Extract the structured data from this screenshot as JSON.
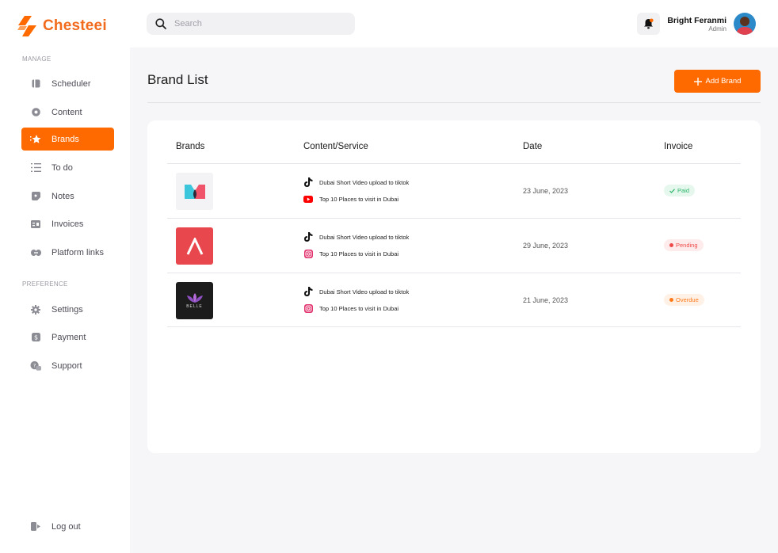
{
  "brand": {
    "name": "Chesteei",
    "accent": "#ff6a00"
  },
  "sidebar": {
    "manage_label": "MANAGE",
    "preference_label": "PREFERENCE",
    "manage_items": [
      {
        "label": "Scheduler",
        "icon": "calendar-icon"
      },
      {
        "label": "Content",
        "icon": "play-icon"
      },
      {
        "label": "Brands",
        "icon": "star-icon",
        "active": true
      },
      {
        "label": "To do",
        "icon": "list-icon"
      },
      {
        "label": "Notes",
        "icon": "note-icon"
      },
      {
        "label": "Invoices",
        "icon": "invoice-icon"
      },
      {
        "label": "Platform links",
        "icon": "link-icon"
      }
    ],
    "preference_items": [
      {
        "label": "Settings",
        "icon": "gear-icon"
      },
      {
        "label": "Payment",
        "icon": "dollar-icon"
      },
      {
        "label": "Support",
        "icon": "support-icon"
      }
    ],
    "logout_label": "Log out"
  },
  "topbar": {
    "search_placeholder": "Search",
    "user_name": "Bright Feranmi",
    "user_role": "Admin"
  },
  "page": {
    "title": "Brand List",
    "add_button": "Add Brand"
  },
  "table": {
    "headers": [
      "Brands",
      "Content/Service",
      "Date",
      "Invoice"
    ],
    "rows": [
      {
        "brand_icon": "m-logo",
        "services": [
          {
            "platform": "tiktok-icon",
            "text": "Dubai Short  Video upload to tiktok"
          },
          {
            "platform": "youtube-icon",
            "text": "Top 10 Places to visit in Dubai"
          }
        ],
        "date": "23 June, 2023",
        "status": "Paid",
        "status_type": "paid"
      },
      {
        "brand_icon": "lambda-logo",
        "services": [
          {
            "platform": "tiktok-icon",
            "text": "Dubai Short  Video upload to tiktok"
          },
          {
            "platform": "instagram-icon",
            "text": "Top 10 Places to visit in Dubai"
          }
        ],
        "date": "29 June, 2023",
        "status": "Pending",
        "status_type": "pending"
      },
      {
        "brand_icon": "belle-logo",
        "brand_text": "BELLE",
        "services": [
          {
            "platform": "tiktok-icon",
            "text": "Dubai Short  Video upload to tiktok"
          },
          {
            "platform": "instagram-icon",
            "text": "Top 10 Places to visit in Dubai"
          }
        ],
        "date": "21 June, 2023",
        "status": "Overdue",
        "status_type": "overdue"
      }
    ]
  }
}
